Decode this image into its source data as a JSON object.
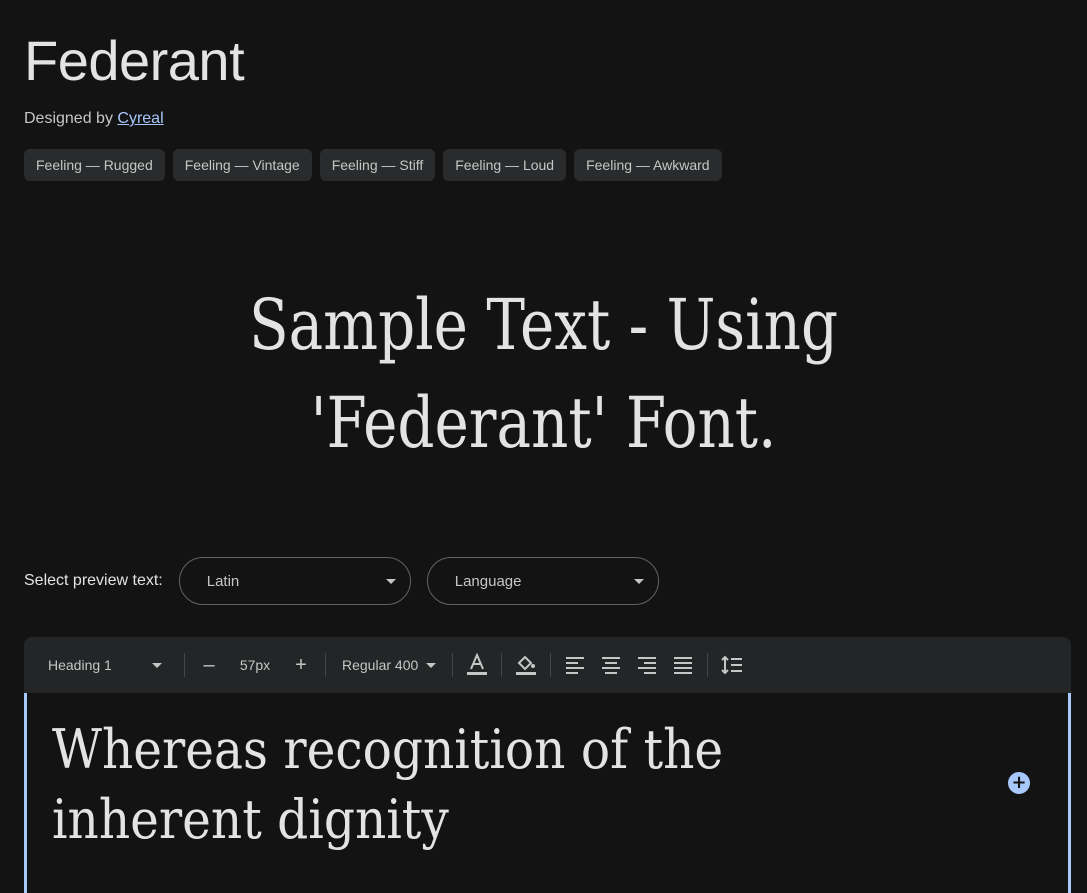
{
  "font": {
    "title": "Federant",
    "designed_by_prefix": "Designed by ",
    "designer": "Cyreal",
    "tags": [
      "Feeling — Rugged",
      "Feeling — Vintage",
      "Feeling — Stiff",
      "Feeling — Loud",
      "Feeling — Awkward"
    ]
  },
  "sample": {
    "line1": "Sample Text - Using",
    "line2": "'Federant' Font."
  },
  "preview": {
    "label": "Select preview text:",
    "script_select": "Latin",
    "language_select": "Language"
  },
  "toolbar": {
    "style": "Heading 1",
    "minus": "–",
    "size": "57px",
    "plus": "+",
    "weight": "Regular 400"
  },
  "editor": {
    "text": "Whereas recognition of the inherent dignity",
    "accent": "#a8c7fa"
  }
}
